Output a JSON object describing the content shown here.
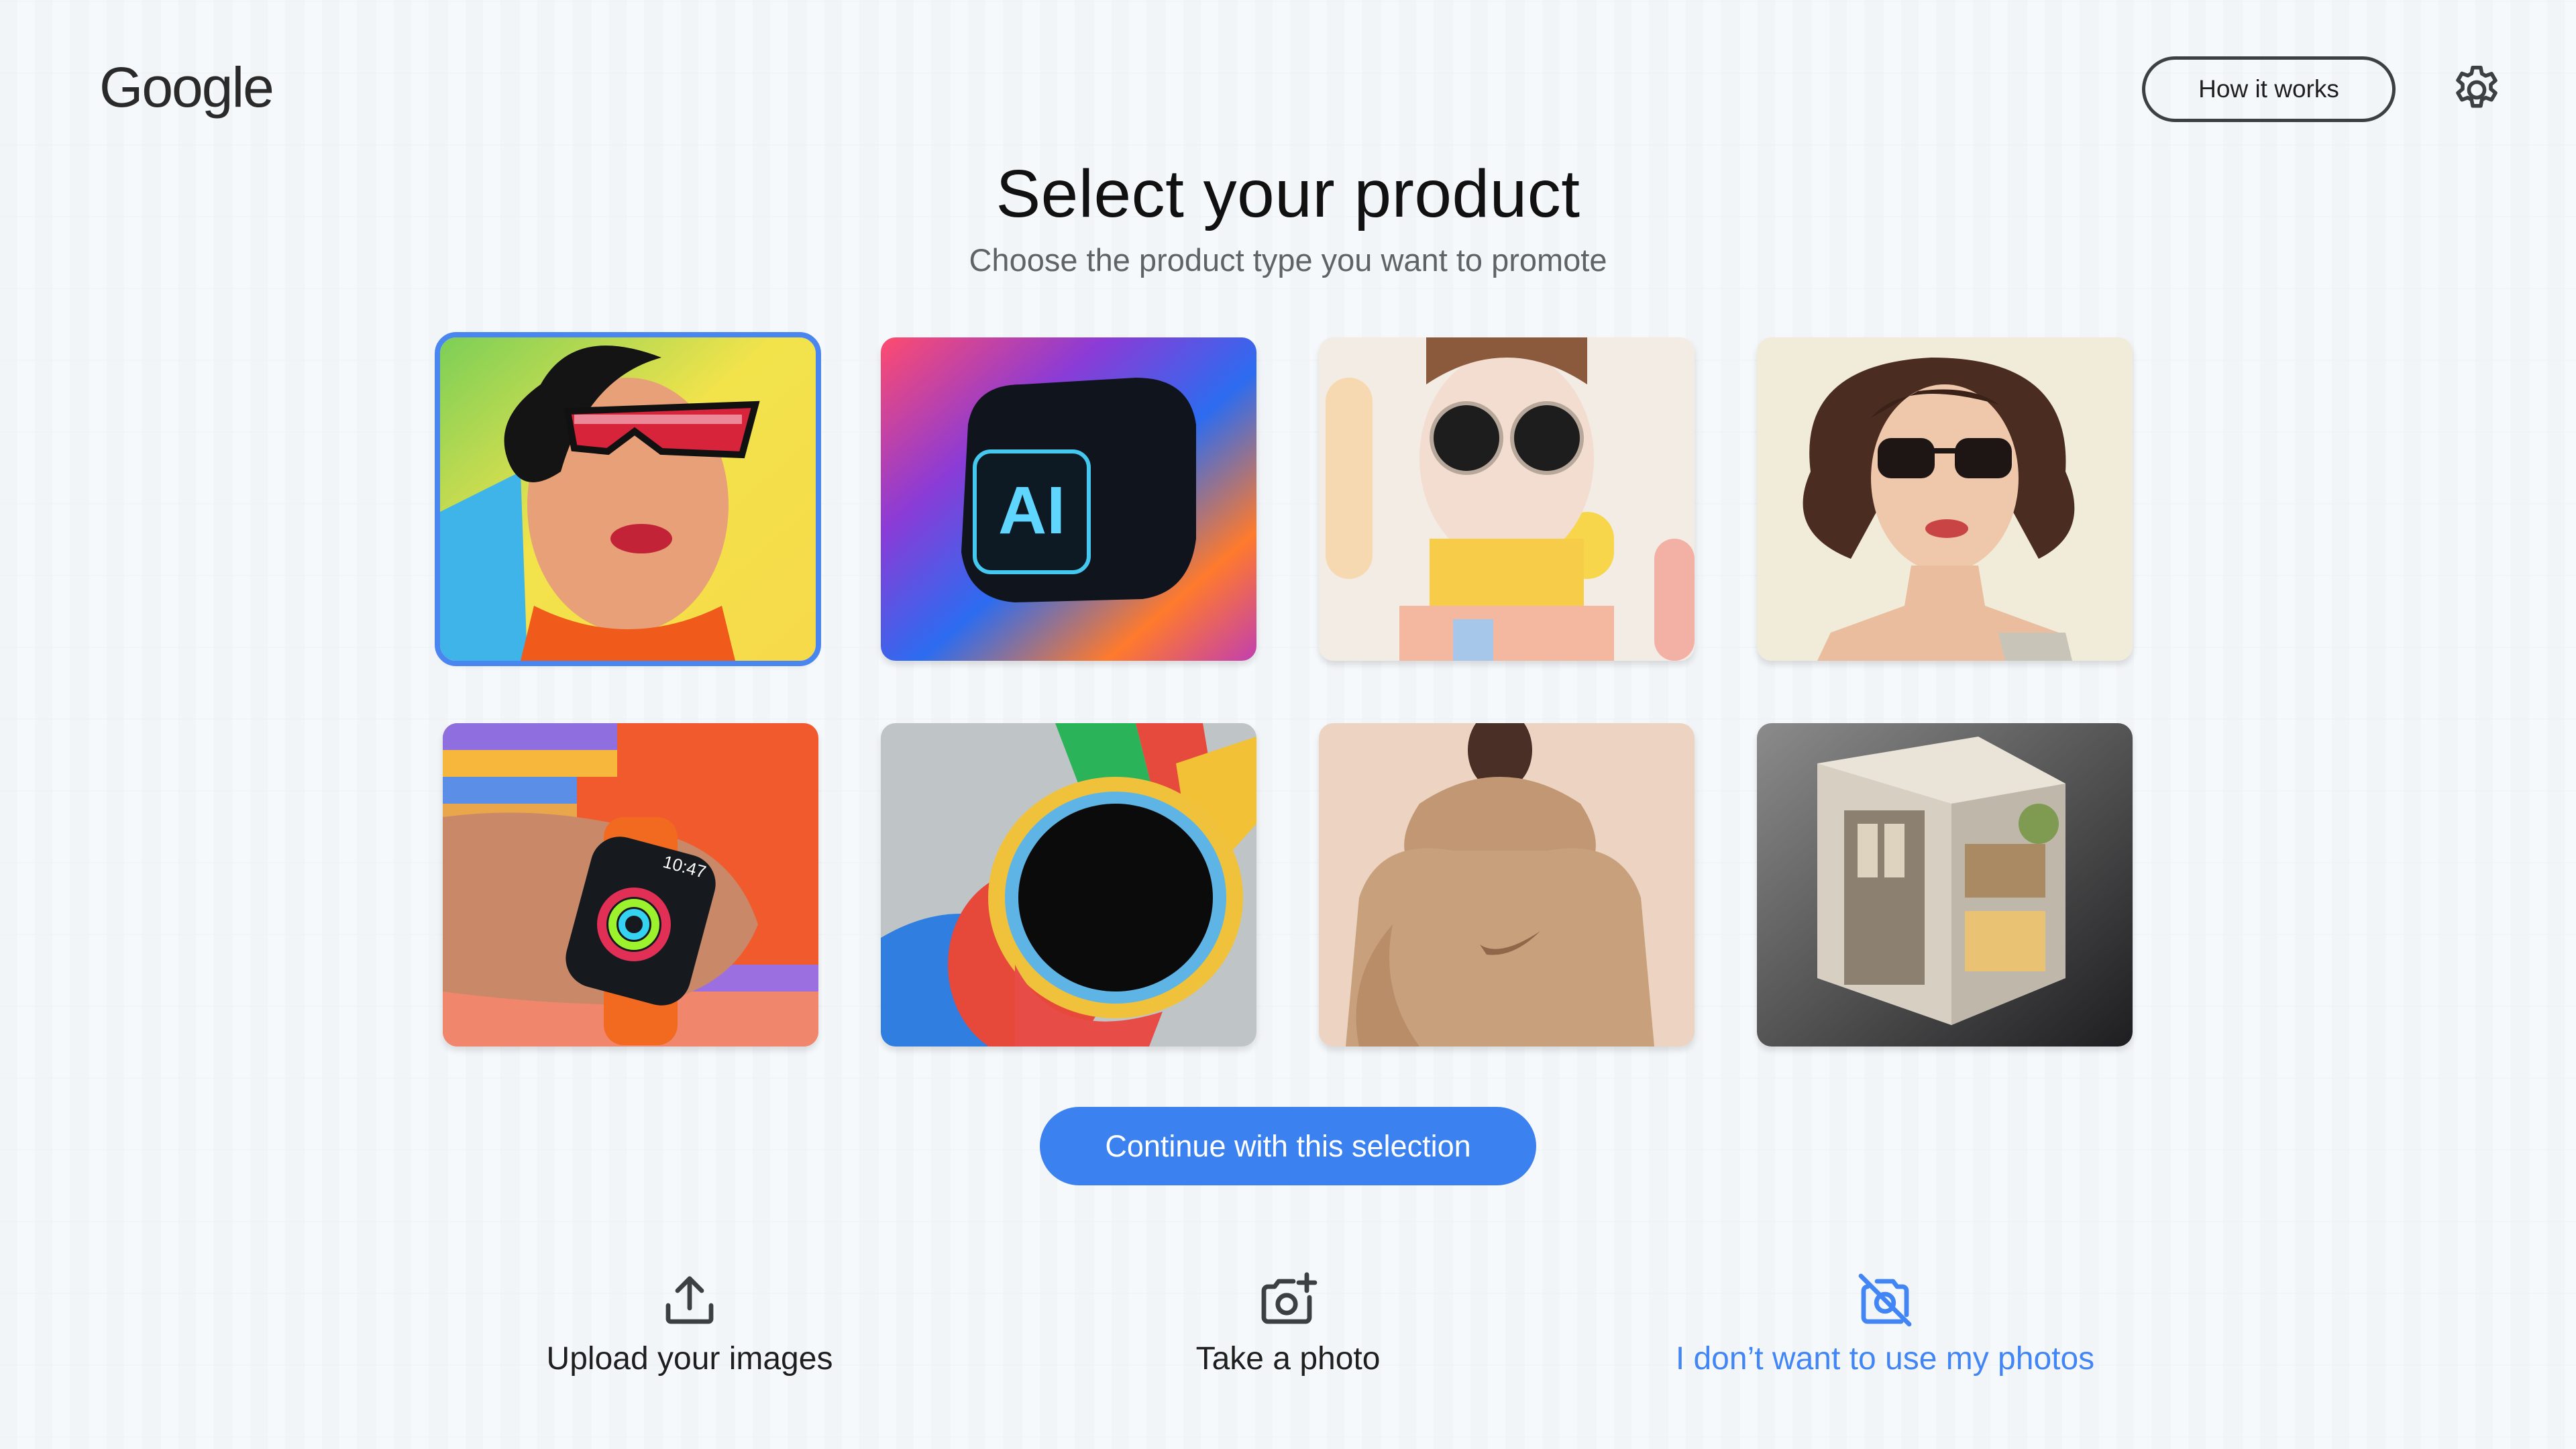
{
  "header": {
    "logo_text": "Google",
    "how_label": "How it works",
    "settings_icon": "gear-icon"
  },
  "main": {
    "title": "Select your product",
    "subtitle": "Choose the product type you want to promote",
    "products": [
      {
        "icon": "woman-red-sunglasses-image",
        "selected": true
      },
      {
        "icon": "ai-cube-image",
        "text": "AI",
        "selected": false
      },
      {
        "icon": "round-sunglasses-figure-image",
        "selected": false
      },
      {
        "icon": "woman-sunglasses-illustration-image",
        "selected": false
      },
      {
        "icon": "smartwatch-wrist-image",
        "watch_time": "10:47",
        "selected": false
      },
      {
        "icon": "colorful-watch-image",
        "selected": false
      },
      {
        "icon": "hoodie-model-image",
        "selected": false
      },
      {
        "icon": "isometric-house-image",
        "selected": false
      }
    ],
    "continue_label": "Continue with this selection"
  },
  "options": {
    "upload": {
      "label": "Upload your images",
      "icon": "upload-icon"
    },
    "photo": {
      "label": "Take a photo",
      "icon": "camera-plus-icon"
    },
    "no_photos": {
      "label": "I don’t want to use my photos",
      "icon": "camera-off-icon"
    }
  },
  "colors": {
    "accent": "#3b82f0",
    "link": "#4285f4",
    "text": "#1f1f1f",
    "muted": "#5f6368"
  }
}
